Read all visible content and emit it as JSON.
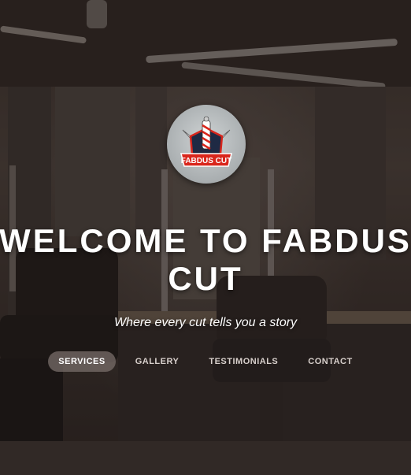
{
  "hero": {
    "logo_alt": "FABDUS CUT",
    "title": "WELCOME TO FABDUS CUT",
    "tagline": "Where every cut tells you a story"
  },
  "nav": {
    "items": [
      {
        "label": "SERVICES",
        "active": true
      },
      {
        "label": "GALLERY",
        "active": false
      },
      {
        "label": "TESTIMONIALS",
        "active": false
      },
      {
        "label": "CONTACT",
        "active": false
      }
    ]
  },
  "colors": {
    "active_pill": "#786e6a",
    "text": "#ffffff",
    "logo_red": "#d9261c",
    "logo_navy": "#1f2a44"
  }
}
